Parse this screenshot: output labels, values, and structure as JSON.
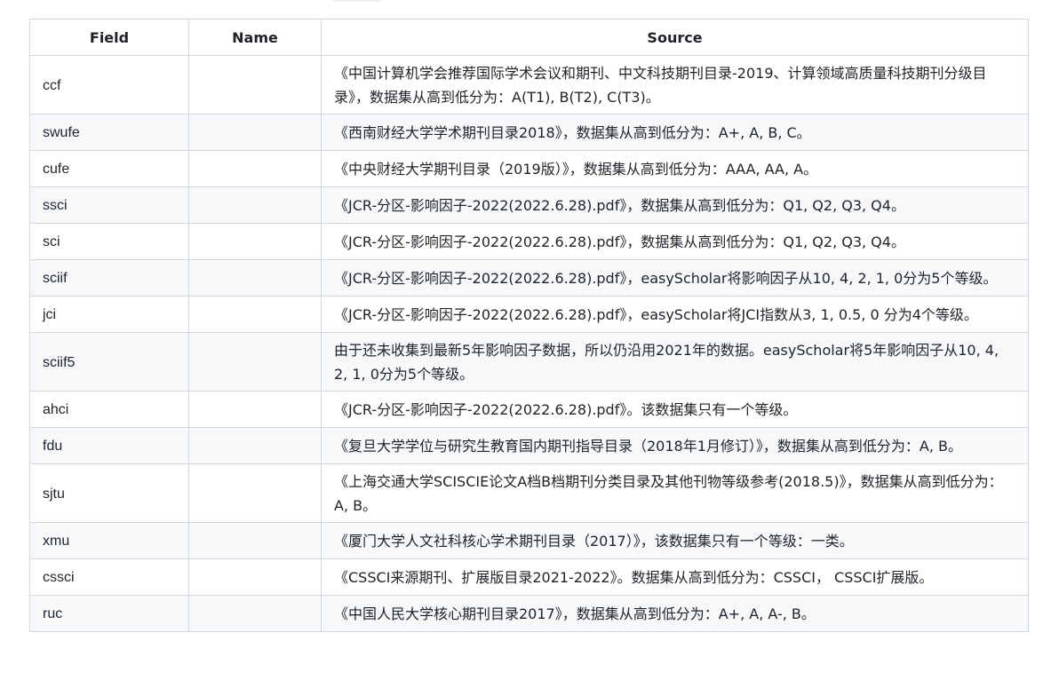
{
  "table": {
    "headers": {
      "field": "Field",
      "name": "Name",
      "source": "Source"
    },
    "rows": [
      {
        "field": "ccf",
        "name": "",
        "source": "《中国计算机学会推荐国际学术会议和期刊、中文科技期刊目录-2019、计算领域高质量科技期刊分级目录》，数据集从高到低分为：A(T1), B(T2), C(T3)。"
      },
      {
        "field": "swufe",
        "name": "",
        "source": "《西南财经大学学术期刊目录2018》，数据集从高到低分为：A+, A, B, C。"
      },
      {
        "field": "cufe",
        "name": "",
        "source": "《中央财经大学期刊目录（2019版）》，数据集从高到低分为：AAA, AA, A。"
      },
      {
        "field": "ssci",
        "name": "",
        "source": "《JCR-分区-影响因子-2022(2022.6.28).pdf》，数据集从高到低分为：Q1, Q2, Q3, Q4。"
      },
      {
        "field": "sci",
        "name": "",
        "source": "《JCR-分区-影响因子-2022(2022.6.28).pdf》，数据集从高到低分为：Q1, Q2, Q3, Q4。"
      },
      {
        "field": "sciif",
        "name": "",
        "source": "《JCR-分区-影响因子-2022(2022.6.28).pdf》，easyScholar将影响因子从10, 4, 2, 1, 0分为5个等级。"
      },
      {
        "field": "jci",
        "name": "",
        "source": "《JCR-分区-影响因子-2022(2022.6.28).pdf》，easyScholar将JCI指数从3, 1, 0.5, 0 分为4个等级。"
      },
      {
        "field": "sciif5",
        "name": "",
        "source": "由于还未收集到最新5年影响因子数据，所以仍沿用2021年的数据。easyScholar将5年影响因子从10, 4, 2, 1, 0分为5个等级。"
      },
      {
        "field": "ahci",
        "name": "",
        "source": "《JCR-分区-影响因子-2022(2022.6.28).pdf》。该数据集只有一个等级。"
      },
      {
        "field": "fdu",
        "name": "",
        "source": "《复旦大学学位与研究生教育国内期刊指导目录（2018年1月修订）》，数据集从高到低分为：A, B。"
      },
      {
        "field": "sjtu",
        "name": "",
        "source": "《上海交通大学SCISCIE论文A档B档期刊分类目录及其他刊物等级参考(2018.5)》，数据集从高到低分为：A, B。"
      },
      {
        "field": "xmu",
        "name": "",
        "source": "《厦门大学人文社科核心学术期刊目录（2017）》，该数据集只有一个等级：一类。"
      },
      {
        "field": "cssci",
        "name": "",
        "source": "《CSSCI来源期刊、扩展版目录2021-2022》。数据集从高到低分为：CSSCI， CSSCI扩展版。"
      },
      {
        "field": "ruc",
        "name": "",
        "source": "《中国人民大学核心期刊目录2017》，数据集从高到低分为：A+, A, A-, B。"
      }
    ]
  }
}
